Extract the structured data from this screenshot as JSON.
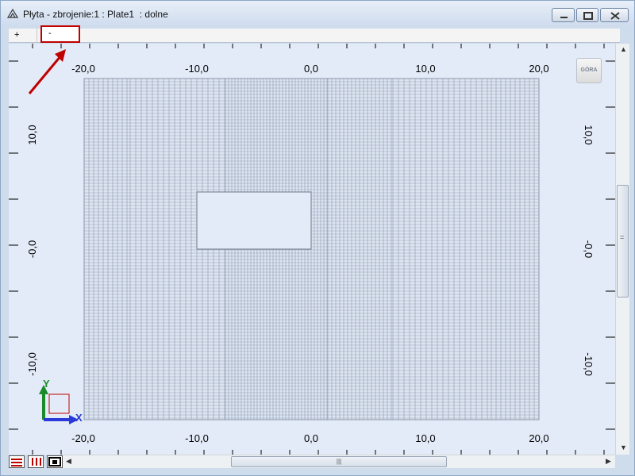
{
  "window": {
    "title": "Płyta - zbrojenie:1 : Plate1  : dolne"
  },
  "tabs": [
    {
      "label": "+"
    },
    {
      "label": "-"
    }
  ],
  "view": {
    "gora_label": "GÓRA",
    "x_tick_labels": [
      "-20,0",
      "-10,0",
      "0,0",
      "10,0",
      "20,0"
    ],
    "y_tick_labels": [
      "10,0",
      "-0,0",
      "-10,0"
    ],
    "axis_x_label": "X",
    "axis_y_label": "Y",
    "colors": {
      "mesh_line": "#8a96a8",
      "background": "#e3ebf8",
      "highlight": "#c00000",
      "axis_x": "#2a3bd8",
      "axis_y": "#1a8a2a"
    }
  },
  "scrollbar": {
    "h_grip": "|||",
    "v_grip": "="
  }
}
